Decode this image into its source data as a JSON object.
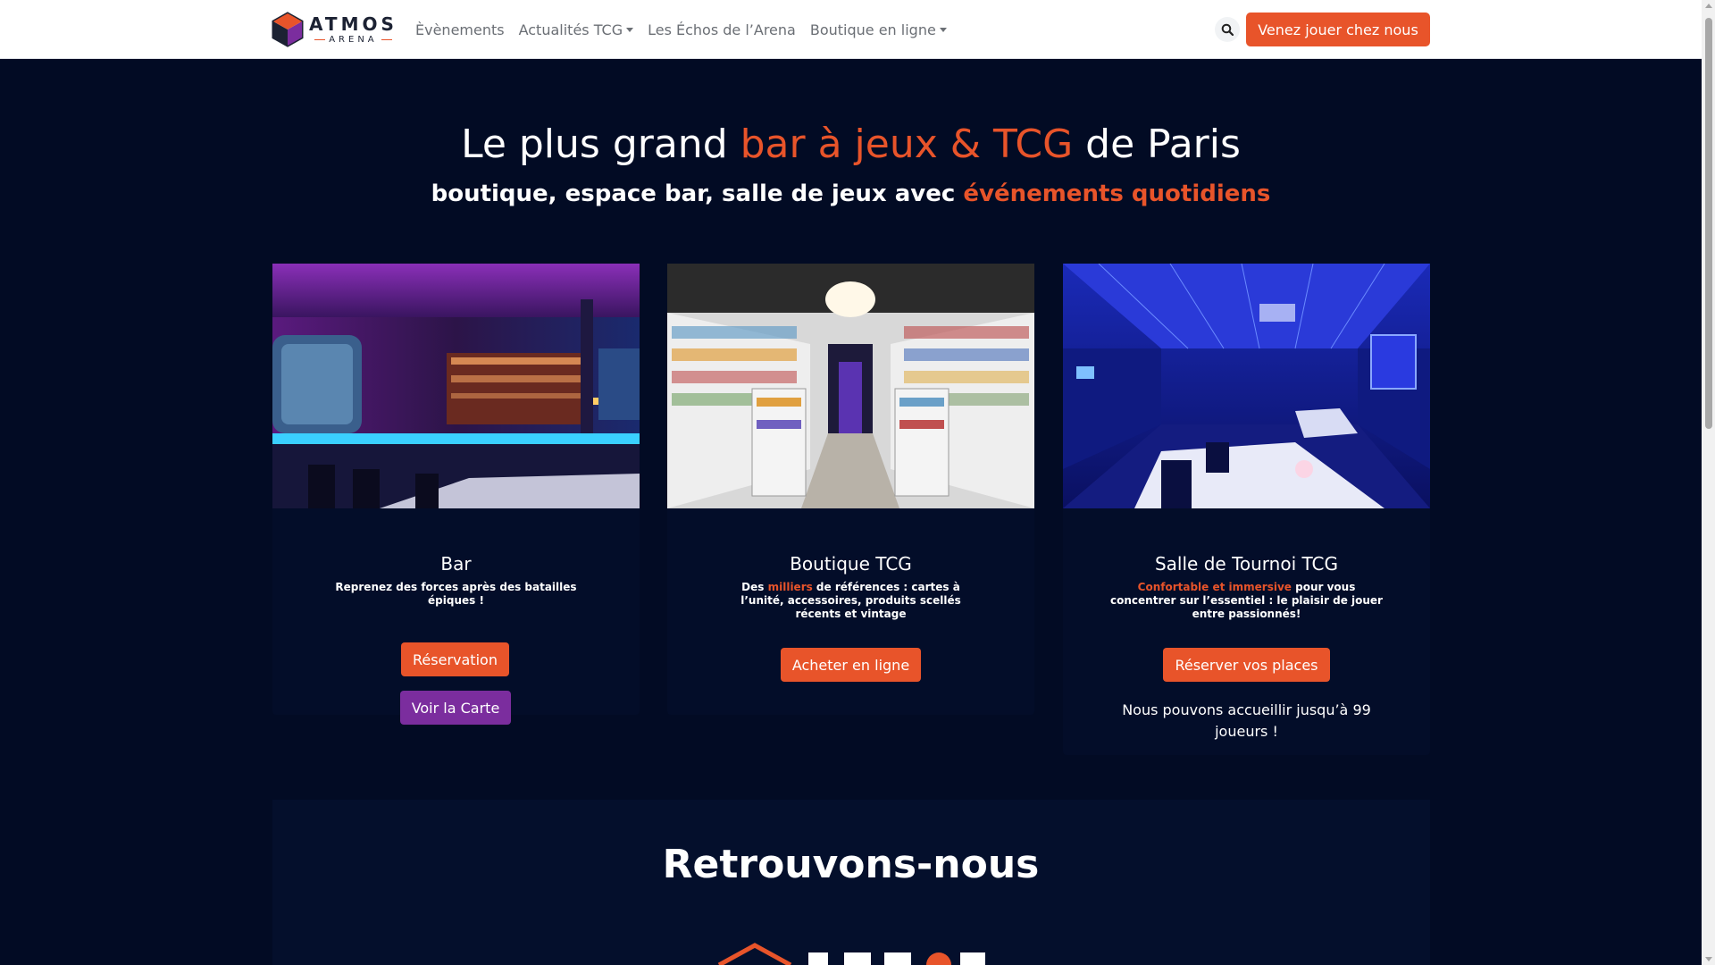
{
  "nav": {
    "brand_name": "ATMOS",
    "brand_sub": "ARENA",
    "links": [
      "Èvènements",
      "Actualités TCG",
      "Les Échos de l’Arena",
      "Boutique en ligne"
    ],
    "cta": "Venez jouer chez nous"
  },
  "hero": {
    "title_pre": "Le plus grand ",
    "title_accent": "bar à jeux & TCG",
    "title_post": " de Paris",
    "sub_pre": "boutique, espace bar, salle de jeux avec ",
    "sub_accent": "événements quotidiens"
  },
  "cards": [
    {
      "title": "Bar",
      "desc_pre": "Reprenez des forces après des batailles épiques !",
      "desc_accent": "",
      "desc_post": "",
      "buttons": [
        "Réservation",
        "Voir la Carte"
      ]
    },
    {
      "title": "Boutique TCG",
      "desc_pre": "Des ",
      "desc_accent": "milliers",
      "desc_post": " de références : cartes à l’unité, accessoires, produits scellés récents et vintage",
      "buttons": [
        "Acheter en ligne"
      ]
    },
    {
      "title": "Salle de Tournoi TCG",
      "desc_pre": "",
      "desc_accent": "Confortable et immersive",
      "desc_post": " pour vous concentrer sur l’essentiel : le plaisir de jouer entre passionnés!",
      "buttons": [
        "Réserver vos places"
      ],
      "capacity": "Nous pouvons accueillir jusqu’à 99 joueurs !"
    }
  ],
  "find_us": "Retrouvons-nous",
  "colors": {
    "accent": "#e8542a",
    "purple": "#7b2d9e",
    "background": "#020b24"
  },
  "icons": [
    "atmos-logo-icon",
    "search-icon",
    "caret-down-icon"
  ]
}
